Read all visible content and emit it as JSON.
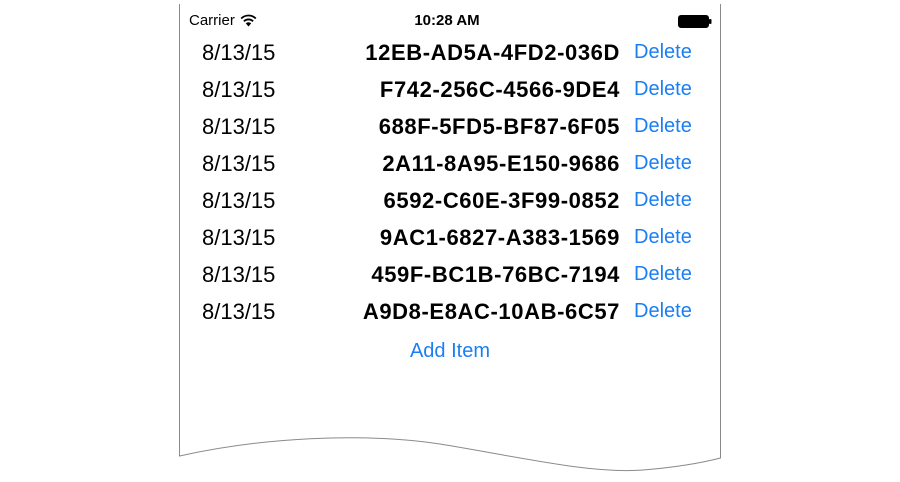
{
  "status_bar": {
    "carrier": "Carrier",
    "time": "10:28 AM"
  },
  "icons": {
    "wifi": "wifi-icon",
    "battery": "battery-icon"
  },
  "rows": [
    {
      "date": "8/13/15",
      "code": "12EB-AD5A-4FD2-036D",
      "action": "Delete"
    },
    {
      "date": "8/13/15",
      "code": "F742-256C-4566-9DE4",
      "action": "Delete"
    },
    {
      "date": "8/13/15",
      "code": "688F-5FD5-BF87-6F05",
      "action": "Delete"
    },
    {
      "date": "8/13/15",
      "code": "2A11-8A95-E150-9686",
      "action": "Delete"
    },
    {
      "date": "8/13/15",
      "code": "6592-C60E-3F99-0852",
      "action": "Delete"
    },
    {
      "date": "8/13/15",
      "code": "9AC1-6827-A383-1569",
      "action": "Delete"
    },
    {
      "date": "8/13/15",
      "code": "459F-BC1B-76BC-7194",
      "action": "Delete"
    },
    {
      "date": "8/13/15",
      "code": "A9D8-E8AC-10AB-6C57",
      "action": "Delete"
    }
  ],
  "add_item_label": "Add Item",
  "colors": {
    "accent": "#1a7ff5",
    "text": "#000000",
    "frame": "#8a8a8a"
  }
}
